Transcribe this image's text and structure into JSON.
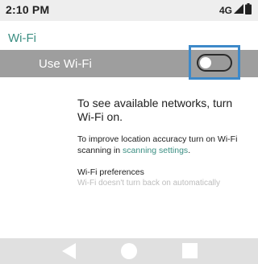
{
  "status_bar": {
    "time": "2:10 PM",
    "network": "4G",
    "icons": [
      "signal-icon",
      "battery-icon"
    ]
  },
  "header": {
    "title": "Wi-Fi"
  },
  "switch_row": {
    "label": "Use Wi-Fi",
    "toggle_on": false
  },
  "empty_state": {
    "message": "To see available networks, turn Wi-Fi on.",
    "scan_text": "To improve location accuracy turn on Wi-Fi scanning in ",
    "scan_link": "scanning settings",
    "scan_suffix": "."
  },
  "preferences": {
    "title": "Wi-Fi preferences",
    "subtitle": "Wi-Fi doesn't turn back on automatically"
  },
  "nav_bar": {
    "icons": [
      "back-icon",
      "home-icon",
      "recents-icon"
    ]
  },
  "colors": {
    "accent": "#3b8e82",
    "switch_bar": "#9e9e9e",
    "highlight": "#3d89c9"
  }
}
